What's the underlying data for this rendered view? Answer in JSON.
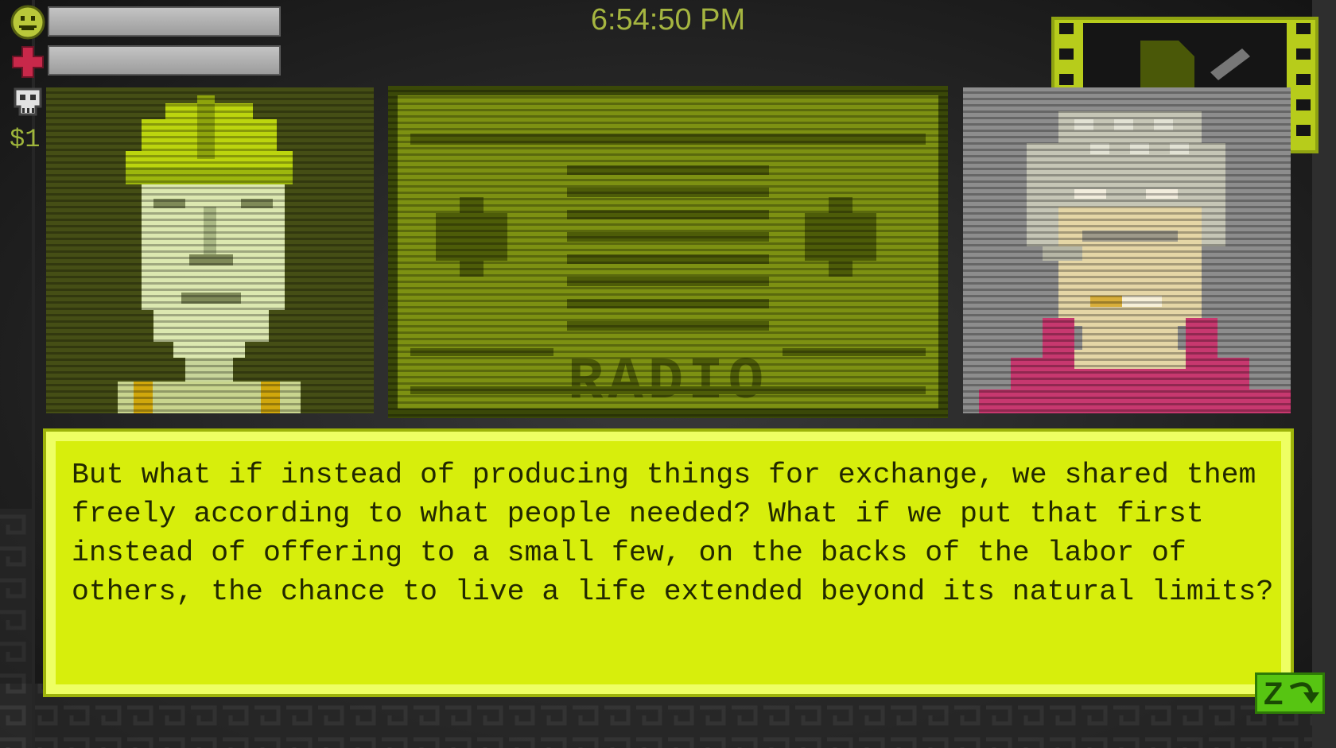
{
  "hud": {
    "time": "6:54:50 PM",
    "money": "$1",
    "mood_bar_level": 1.0,
    "health_bar_level": 1.0
  },
  "dialogue": {
    "text": "But what if instead of producing things for exchange, we shared them freely according to what people needed? What if we put that first instead of offering to a small few, on the backs of the labor of others, the chance to live a life extended beyond its natural limits?",
    "advance_key": "Z"
  },
  "center_card": {
    "label": "RADIO",
    "icon": "radio-icon"
  },
  "colors": {
    "accent_lime": "#d7ee0c",
    "dialogue_text": "#222800",
    "clock": "#a5b540",
    "advance_button": "#57c512"
  },
  "icons": [
    "smiley-face-icon",
    "red-cross-icon",
    "skull-icon",
    "film-strip-icon",
    "hard-hat-worker-portrait",
    "elderly-woman-portrait",
    "advance-arrow-icon"
  ]
}
